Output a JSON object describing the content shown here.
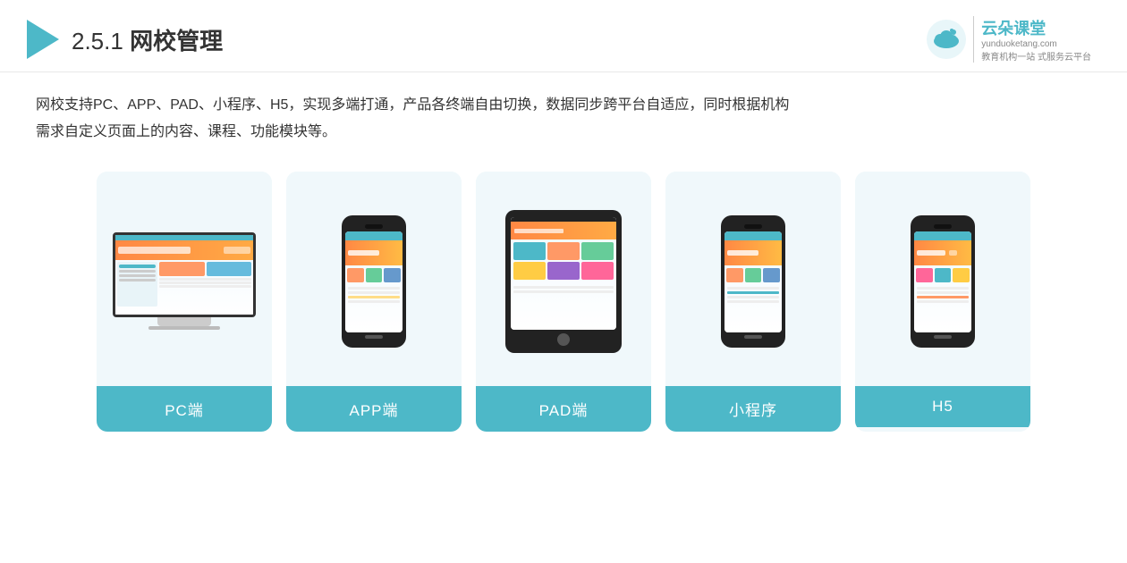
{
  "header": {
    "section_number": "2.5.1",
    "title_plain": "网校管理",
    "logo_brand": "云朵课堂",
    "logo_url": "yunduoketang.com",
    "logo_tagline1": "教育机构一站",
    "logo_tagline2": "式服务云平台"
  },
  "description": {
    "line1": "网校支持PC、APP、PAD、小程序、H5，实现多端打通，产品各终端自由切换，数据同步跨平台自适应，同时根据机构",
    "line2": "需求自定义页面上的内容、课程、功能模块等。"
  },
  "cards": [
    {
      "id": "pc",
      "label": "PC端",
      "device_type": "desktop"
    },
    {
      "id": "app",
      "label": "APP端",
      "device_type": "phone"
    },
    {
      "id": "pad",
      "label": "PAD端",
      "device_type": "tablet"
    },
    {
      "id": "miniprogram",
      "label": "小程序",
      "device_type": "phone"
    },
    {
      "id": "h5",
      "label": "H5",
      "device_type": "phone"
    }
  ],
  "colors": {
    "accent": "#4db8c8",
    "card_bg": "#f0f8fb",
    "text_dark": "#333333",
    "label_bg": "#4db8c8",
    "label_text": "#ffffff"
  }
}
